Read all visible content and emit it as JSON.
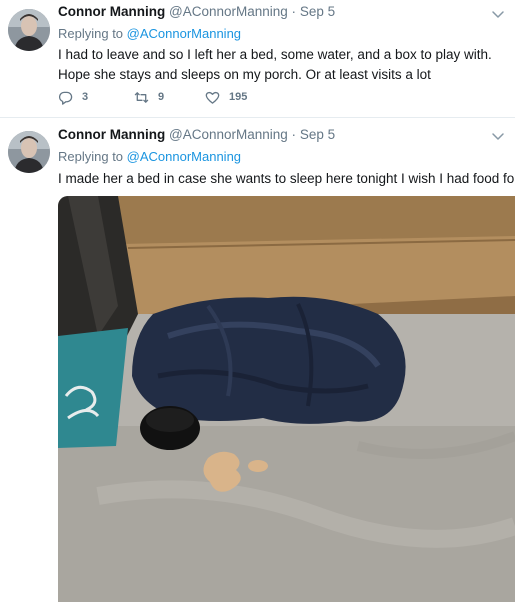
{
  "tweets": [
    {
      "name": "Connor Manning",
      "handle": "@AConnorManning",
      "dot": "·",
      "date": "Sep 5",
      "reply_prefix": "Replying to ",
      "reply_to": "@AConnorManning",
      "text": "I had to leave and so I left her a bed, some water, and a box to play with. Hope she stays and sleeps on my porch. Or at least visits a lot",
      "replies": "3",
      "retweets": "9",
      "likes": "195"
    },
    {
      "name": "Connor Manning",
      "handle": "@AConnorManning",
      "dot": "·",
      "date": "Sep 5",
      "reply_prefix": "Replying to ",
      "reply_to": "@AConnorManning",
      "text": "I made her a bed in case she wants to sleep here tonight I wish I had food for her"
    }
  ],
  "icons": {
    "reply": "speech-bubble",
    "retweet": "retweet-arrows",
    "like": "heart",
    "menu": "chevron-down"
  },
  "colors": {
    "text": "#14171a",
    "secondary": "#657786",
    "link": "#1b95e0",
    "divider": "#e6ecf0"
  }
}
